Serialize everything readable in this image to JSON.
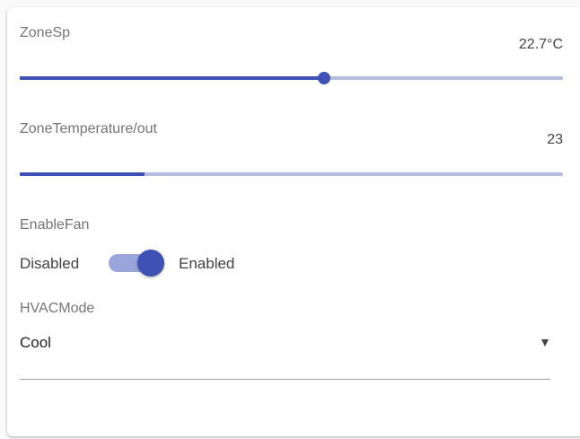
{
  "zone_sp": {
    "label": "ZoneSp",
    "value_text": "22.7°C",
    "level": 0.56
  },
  "zone_temperature": {
    "label": "ZoneTemperature/out",
    "value_text": "23",
    "level": 0.23
  },
  "enable_fan": {
    "label": "EnableFan",
    "off_text": "Disabled",
    "on_text": "Enabled",
    "state": "on"
  },
  "hvac_mode": {
    "label": "HVACMode",
    "selected": "Cool"
  },
  "colors": {
    "accent": "#3f51b5",
    "track": "#b6bde4",
    "switch_track": "#9aa5dc"
  },
  "icons": {
    "dropdown": "triangle-down-icon"
  }
}
